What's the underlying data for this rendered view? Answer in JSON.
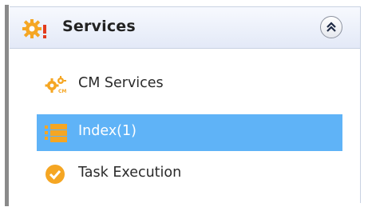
{
  "panel": {
    "title": "Services",
    "title_icon": "gear-warning-icon",
    "collapse_icon": "double-chevron-up-icon"
  },
  "items": [
    {
      "label": "CM Services",
      "icon": "cm-gears-icon",
      "selected": false
    },
    {
      "label": "Index(1)",
      "icon": "index-tree-icon",
      "selected": true
    },
    {
      "label": "Task Execution",
      "icon": "check-circle-icon",
      "selected": false
    }
  ],
  "colors": {
    "selection": "#5fb3f7",
    "icon_orange": "#f5a623",
    "header_gradient_top": "#f7f9fe",
    "header_gradient_bottom": "#e3e9f7"
  }
}
